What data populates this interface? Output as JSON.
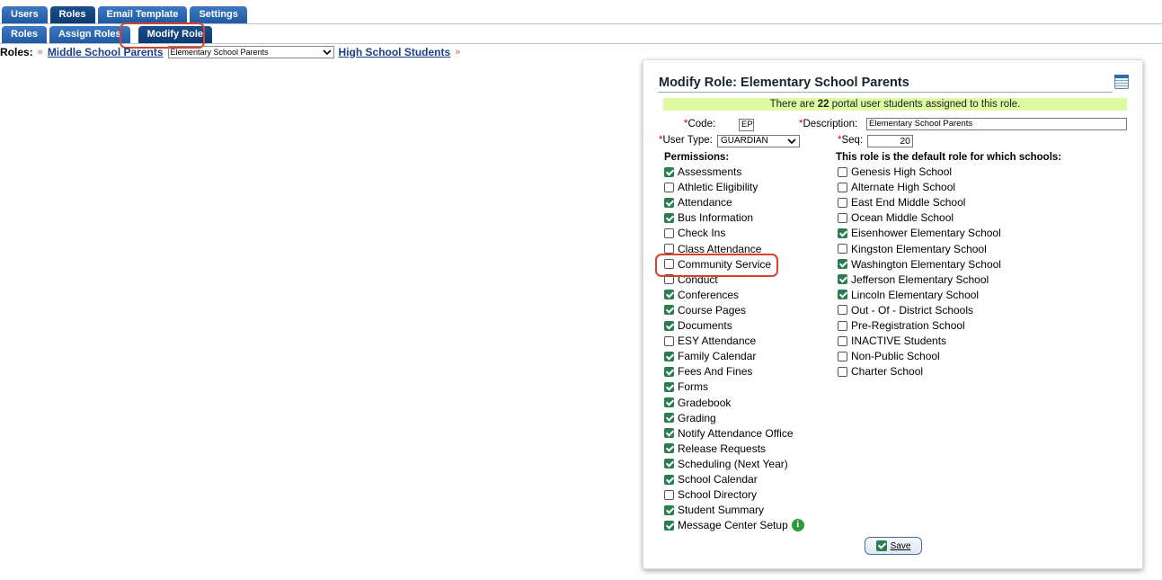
{
  "top_tabs": [
    "Users",
    "Roles",
    "Email Template",
    "Settings"
  ],
  "sub_tabs": [
    "Roles",
    "Assign Roles",
    "Modify Role"
  ],
  "roles_nav": {
    "label": "Roles:",
    "prev_arrow": "«",
    "prev_role": "Middle School Parents",
    "selected_role": "Elementary School Parents",
    "next_role": "High School Students",
    "next_arrow": "»"
  },
  "panel": {
    "title": "Modify Role: Elementary School Parents",
    "notice_prefix": "There are ",
    "notice_count": "22",
    "notice_suffix": " portal user students assigned to this role.",
    "required_mark": "*",
    "code_label": "Code:",
    "code_value": "EP",
    "description_label": "Description:",
    "description_value": "Elementary School Parents",
    "user_type_label": "User Type:",
    "user_type_value": "GUARDIAN",
    "seq_label": "Seq:",
    "seq_value": "20",
    "permissions_header": "Permissions:",
    "schools_header": "This role is the default role for which schools:",
    "permissions": [
      {
        "label": "Assessments",
        "checked": true
      },
      {
        "label": "Athletic Eligibility",
        "checked": false
      },
      {
        "label": "Attendance",
        "checked": true
      },
      {
        "label": "Bus Information",
        "checked": true
      },
      {
        "label": "Check Ins",
        "checked": false
      },
      {
        "label": "Class Attendance",
        "checked": false
      },
      {
        "label": "Community Service",
        "checked": false
      },
      {
        "label": "Conduct",
        "checked": false
      },
      {
        "label": "Conferences",
        "checked": true
      },
      {
        "label": "Course Pages",
        "checked": true
      },
      {
        "label": "Documents",
        "checked": true
      },
      {
        "label": "ESY Attendance",
        "checked": false
      },
      {
        "label": "Family Calendar",
        "checked": true
      },
      {
        "label": "Fees And Fines",
        "checked": true
      },
      {
        "label": "Forms",
        "checked": true
      },
      {
        "label": "Gradebook",
        "checked": true
      },
      {
        "label": "Grading",
        "checked": true
      },
      {
        "label": "Notify Attendance Office",
        "checked": true
      },
      {
        "label": "Release Requests",
        "checked": true
      },
      {
        "label": "Scheduling (Next Year)",
        "checked": true
      },
      {
        "label": "School Calendar",
        "checked": true
      },
      {
        "label": "School Directory",
        "checked": false
      },
      {
        "label": "Student Summary",
        "checked": true
      },
      {
        "label": "Message Center Setup",
        "checked": true
      }
    ],
    "schools": [
      {
        "label": "Genesis High School",
        "checked": false
      },
      {
        "label": "Alternate High School",
        "checked": false
      },
      {
        "label": "East End Middle School",
        "checked": false
      },
      {
        "label": "Ocean Middle School",
        "checked": false
      },
      {
        "label": "Eisenhower Elementary School",
        "checked": true
      },
      {
        "label": "Kingston Elementary School",
        "checked": false
      },
      {
        "label": "Washington Elementary School",
        "checked": true
      },
      {
        "label": "Jefferson Elementary School",
        "checked": true
      },
      {
        "label": "Lincoln Elementary School",
        "checked": true
      },
      {
        "label": "Out - Of - District Schools",
        "checked": false
      },
      {
        "label": "Pre-Registration School",
        "checked": false
      },
      {
        "label": "INACTIVE Students",
        "checked": false
      },
      {
        "label": "Non-Public School",
        "checked": false
      },
      {
        "label": "Charter School",
        "checked": false
      }
    ],
    "info_icon_glyph": "i",
    "save_label": "Save"
  },
  "colors": {
    "tab_blue": "#1f5aa3",
    "highlight_red": "#d9412d",
    "notice_green": "#ddf9a2",
    "checkbox_green": "#2a7d4f",
    "link_blue": "#1c3f87"
  }
}
